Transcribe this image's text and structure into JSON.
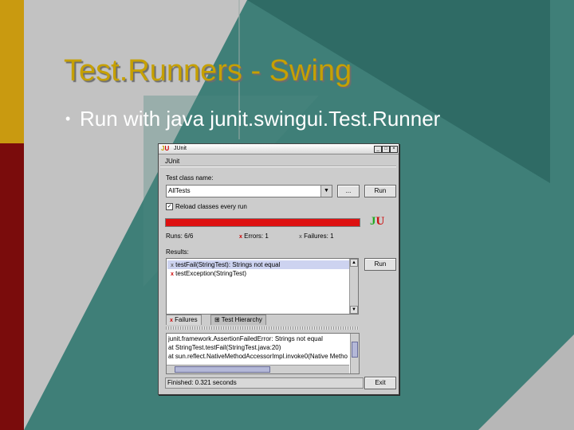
{
  "slide": {
    "title": "Test.Runners - Swing",
    "bullet": "Run with java junit.swingui.Test.Runner"
  },
  "window": {
    "title": "JUnit",
    "menu": "JUnit",
    "test_class_label": "Test class name:",
    "test_class_value": "AllTests",
    "browse_label": "...",
    "run_label": "Run",
    "reload_label": "Reload classes every run",
    "reload_checked": true,
    "progress_fraction": 1.0,
    "runs_label": "Runs:",
    "runs_value": "6/6",
    "errors_label": "Errors:",
    "errors_value": "1",
    "failures_label": "Failures:",
    "failures_value": "1",
    "results_label": "Results:",
    "results": [
      "testFail(StringTest): Strings not equal",
      "testException(StringTest)"
    ],
    "rerun_label": "Run",
    "tabs": [
      "Failures",
      "Test Hierarchy"
    ],
    "trace_lines": [
      "junit.framework.AssertionFailedError: Strings not equal",
      "at StringTest.testFail(StringTest.java:20)",
      "at sun.reflect.NativeMethodAccessorImpl.invoke0(Native Metho"
    ],
    "status_text": "Finished: 0.321 seconds",
    "exit_label": "Exit"
  },
  "colors": {
    "progress": "#dd1111",
    "title_text": "#c6a000",
    "background": "#3f7f78"
  }
}
